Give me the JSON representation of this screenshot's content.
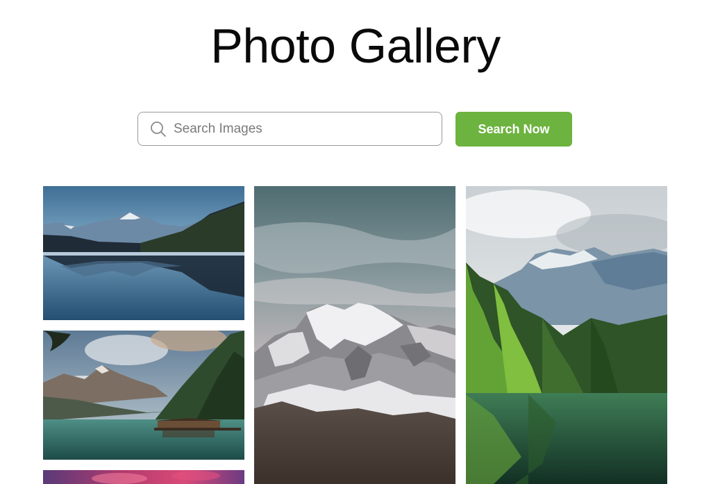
{
  "header": {
    "title": "Photo Gallery"
  },
  "search": {
    "placeholder": "Search Images",
    "value": "",
    "button_label": "Search Now",
    "icon": "search-icon",
    "button_color": "#6db33f"
  },
  "gallery": {
    "items": [
      {
        "subject": "mountain-lake-reflection-photo"
      },
      {
        "subject": "snowy-mountain-peak-photo"
      },
      {
        "subject": "forest-lake-mountain-photo"
      },
      {
        "subject": "lake-cabin-mountains-photo"
      },
      {
        "subject": "sunset-clouds-photo"
      }
    ]
  }
}
